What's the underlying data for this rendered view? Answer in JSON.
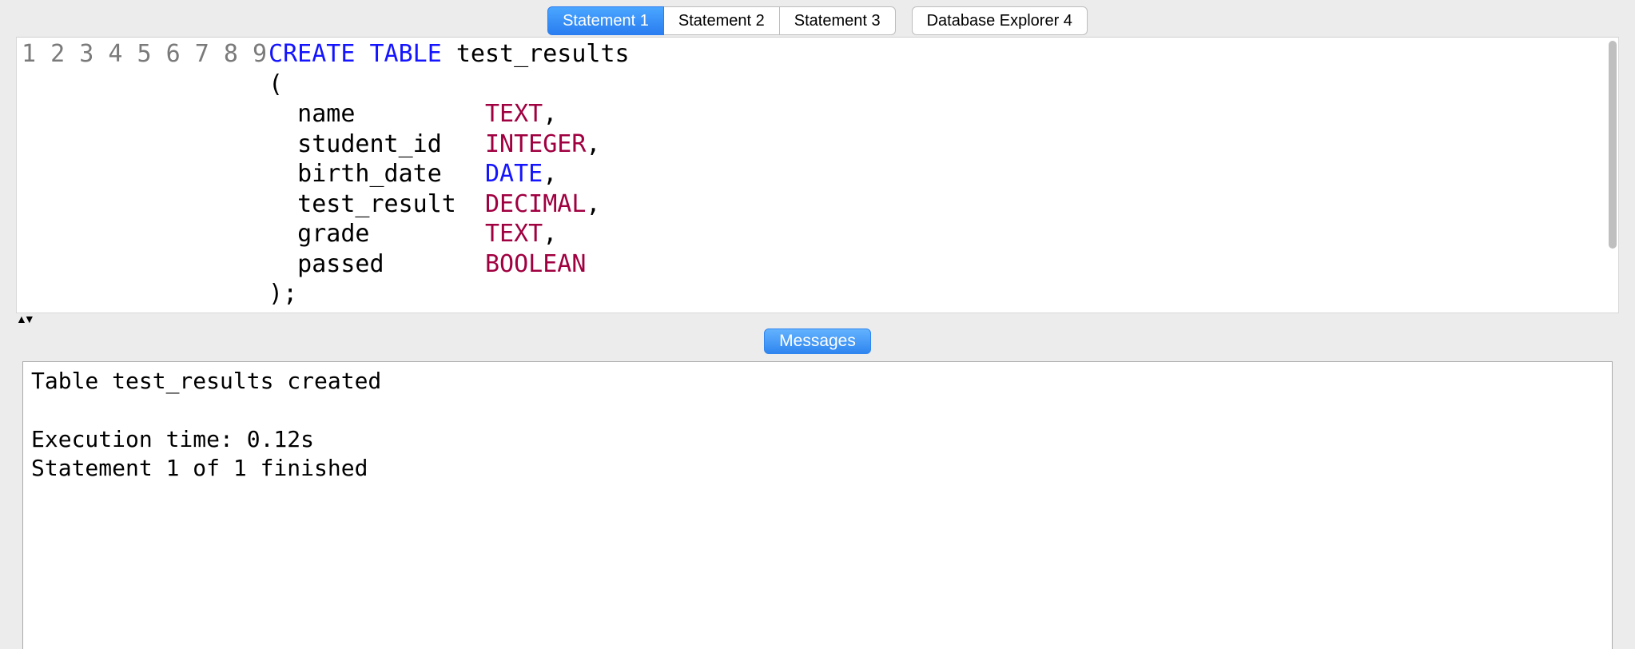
{
  "tabs": {
    "items": [
      {
        "label": "Statement 1",
        "active": true
      },
      {
        "label": "Statement 2",
        "active": false
      },
      {
        "label": "Statement 3",
        "active": false
      }
    ],
    "extra": {
      "label": "Database Explorer 4",
      "active": false
    }
  },
  "editor": {
    "gutter": [
      "1",
      "2",
      "3",
      "4",
      "5",
      "6",
      "7",
      "8",
      "9"
    ],
    "tokens": [
      [
        {
          "t": "CREATE TABLE",
          "c": "kw"
        },
        {
          "t": " test_results",
          "c": ""
        }
      ],
      [
        {
          "t": "(",
          "c": ""
        }
      ],
      [
        {
          "t": "  name         ",
          "c": ""
        },
        {
          "t": "TEXT",
          "c": "ty"
        },
        {
          "t": ",",
          "c": ""
        }
      ],
      [
        {
          "t": "  student_id   ",
          "c": ""
        },
        {
          "t": "INTEGER",
          "c": "ty"
        },
        {
          "t": ",",
          "c": ""
        }
      ],
      [
        {
          "t": "  birth_date   ",
          "c": ""
        },
        {
          "t": "DATE",
          "c": "kw"
        },
        {
          "t": ",",
          "c": ""
        }
      ],
      [
        {
          "t": "  test_result  ",
          "c": ""
        },
        {
          "t": "DECIMAL",
          "c": "ty"
        },
        {
          "t": ",",
          "c": ""
        }
      ],
      [
        {
          "t": "  grade        ",
          "c": ""
        },
        {
          "t": "TEXT",
          "c": "ty"
        },
        {
          "t": ",",
          "c": ""
        }
      ],
      [
        {
          "t": "  passed       ",
          "c": ""
        },
        {
          "t": "BOOLEAN",
          "c": "ty"
        }
      ],
      [
        {
          "t": ");",
          "c": ""
        }
      ]
    ]
  },
  "messages_tab": {
    "label": "Messages"
  },
  "messages": {
    "lines": [
      "Table test_results created",
      "",
      "Execution time: 0.12s",
      "Statement 1 of 1 finished"
    ]
  }
}
